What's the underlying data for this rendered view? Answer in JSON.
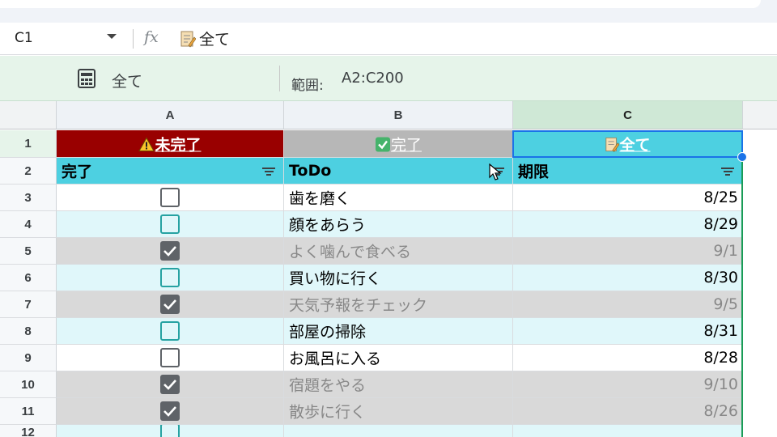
{
  "formula_bar": {
    "name_box": "C1",
    "fx_label": "fx",
    "content": "全て"
  },
  "filter_view": {
    "name": "全て",
    "range_label": "範囲:",
    "range": "A2:C200"
  },
  "column_headers": [
    "A",
    "B",
    "C"
  ],
  "row_numbers": [
    "1",
    "2",
    "3",
    "4",
    "5",
    "6",
    "7",
    "8",
    "9",
    "10",
    "11",
    "12"
  ],
  "buttons": {
    "incomplete": "未完了",
    "complete": "完了",
    "all": "全て"
  },
  "table_headers": {
    "done": "完了",
    "todo": "ToDo",
    "due": "期限"
  },
  "rows": [
    {
      "done": false,
      "task": "歯を磨く",
      "due": "8/25"
    },
    {
      "done": false,
      "task": "顔をあらう",
      "due": "8/29"
    },
    {
      "done": true,
      "task": "よく噛んで食べる",
      "due": "9/1"
    },
    {
      "done": false,
      "task": "買い物に行く",
      "due": "8/30"
    },
    {
      "done": true,
      "task": "天気予報をチェック",
      "due": "9/5"
    },
    {
      "done": false,
      "task": "部屋の掃除",
      "due": "8/31"
    },
    {
      "done": false,
      "task": "お風呂に入る",
      "due": "8/28"
    },
    {
      "done": true,
      "task": "宿題をやる",
      "due": "9/10"
    },
    {
      "done": true,
      "task": "散歩に行く",
      "due": "8/26"
    },
    {
      "done": false,
      "task": "",
      "due": ""
    }
  ],
  "colors": {
    "incomplete_btn": "#990000",
    "complete_btn": "#b7b7b7",
    "all_btn": "#4dd0e1",
    "header": "#4dd0e1",
    "row_white": "#ffffff",
    "row_light": "#e0f7fa",
    "row_done": "#d9d9d9",
    "text_done": "#888888",
    "checkbox_teal": "#26a2a2"
  },
  "icons": {
    "warning": "warning-icon",
    "check": "checkbox-checked-icon",
    "memo": "memo-icon",
    "filter": "filter-icon",
    "filter_view": "filter-view-icon"
  }
}
